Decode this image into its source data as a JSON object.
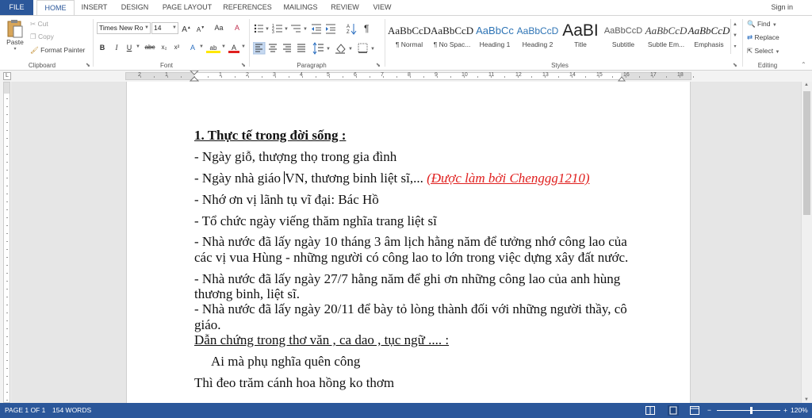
{
  "tabs": {
    "file": "FILE",
    "items": [
      "HOME",
      "INSERT",
      "DESIGN",
      "PAGE LAYOUT",
      "REFERENCES",
      "MAILINGS",
      "REVIEW",
      "VIEW"
    ],
    "active": "HOME",
    "sign_in": "Sign in"
  },
  "clipboard": {
    "paste": "Paste",
    "cut": "Cut",
    "copy": "Copy",
    "format_painter": "Format Painter",
    "label": "Clipboard"
  },
  "font": {
    "name": "Times New Ro",
    "size": "14",
    "label": "Font",
    "bold": "B",
    "italic": "I",
    "underline": "U",
    "strike": "abc",
    "subscript": "x₂",
    "superscript": "x²",
    "grow": "A",
    "shrink": "A",
    "case": "Aa",
    "font_color_a": "A",
    "effects_a": "A",
    "highlight_a": "ab"
  },
  "paragraph": {
    "label": "Paragraph",
    "show_marks": "¶"
  },
  "styles": {
    "label": "Styles",
    "items": [
      {
        "preview": "AaBbCcD",
        "name": "¶ Normal"
      },
      {
        "preview": "AaBbCcD",
        "name": "¶ No Spac..."
      },
      {
        "preview": "AaBbCc",
        "name": "Heading 1"
      },
      {
        "preview": "AaBbCcD",
        "name": "Heading 2"
      },
      {
        "preview": "AaBI",
        "name": "Title"
      },
      {
        "preview": "AaBbCcD",
        "name": "Subtitle"
      },
      {
        "preview": "AaBbCcD",
        "name": "Subtle Em..."
      },
      {
        "preview": "AaBbCcD",
        "name": "Emphasis"
      }
    ]
  },
  "editing": {
    "label": "Editing",
    "find": "Find",
    "replace": "Replace",
    "select": "Select"
  },
  "ruler": {
    "numbers": [
      "2",
      "1",
      "1",
      "2",
      "3",
      "4",
      "5",
      "6",
      "7",
      "8",
      "9",
      "10",
      "11",
      "12",
      "13",
      "14",
      "15",
      "16",
      "17",
      "18"
    ]
  },
  "document": {
    "heading": "1. Thực tế trong đời sống :",
    "line_1": "- Ngày giỗ, thượng thọ trong gia đình",
    "line_2_pre": "- Ngày nhà giáo ",
    "line_2_post": "VN, thương binh liệt sĩ,... ",
    "line_2_credit": "(Được làm bởi Chenggg1210)",
    "line_3": "- Nhớ ơn vị lãnh tụ vĩ đại: Bác Hồ",
    "line_4": "- Tổ chức ngày viếng thăm nghĩa trang liệt sĩ",
    "line_5a": "- Nhà nước đã lấy ngày 10 tháng 3 âm lịch hằng năm để tưởng nhớ công lao của",
    "line_5b": "các vị vua Hùng - những người có công lao to lớn trong việc dựng xây đất nước.",
    "line_6a": "- Nhà nước đã lấy ngày 27/7 hằng năm để ghi ơn những công lao của anh hùng",
    "line_6b": "thương binh, liệt sĩ.",
    "line_7a": "- Nhà nước đã lấy ngày 20/11 để bày tỏ lòng thành đối với những người thầy, cô",
    "line_7b": "giáo.",
    "line_8": "Dẫn chứng trong thơ văn , ca dao , tục ngữ .... :",
    "line_9": "Ai mà phụ nghĩa quên công",
    "line_10": "Thì đeo trăm cánh hoa hồng ko thơm"
  },
  "status": {
    "page": "PAGE 1 OF 1",
    "words": "154 WORDS",
    "zoom": "120%"
  },
  "colors": {
    "accent": "#2b579a",
    "credit_red": "#e0201f"
  }
}
